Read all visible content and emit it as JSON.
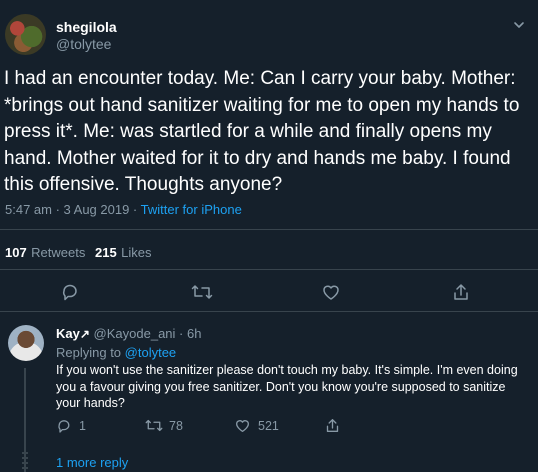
{
  "tweet": {
    "author_name": "shegilola",
    "author_handle": "@tolytee",
    "text_lines": [
      "I had an encounter today. Me: Can I carry your baby. Mother:",
      "*brings out hand sanitizer waiting for me to open my hands to",
      "press it*. Me: was startled for a while and finally opens my",
      "hand.  Mother waited for it to dry and hands me baby. I found",
      "this offensive. Thoughts anyone?"
    ],
    "timestamp": "5:47 am · 3 Aug 2019 · ",
    "source": "Twitter for iPhone",
    "retweets_count": "107",
    "retweets_label": "Retweets",
    "likes_count": "215",
    "likes_label": "Likes",
    "menu_icon": "chevron-down-icon"
  },
  "reply": {
    "author_name": "Kay",
    "author_badge": "↗",
    "author_handle": "@Kayode_ani · 6h",
    "replying_to_label": "Replying to ",
    "replying_to_handle": "@tolytee",
    "text_lines": [
      "If you won't use the sanitizer please don't touch my baby. It's simple. I'm even doing",
      "you a favour giving you free sanitizer. Don't you know you're supposed to sanitize",
      "your hands?"
    ],
    "reply_count": "1",
    "retweet_count": "78",
    "like_count": "521",
    "more_replies": "1 more reply"
  },
  "colors": {
    "background": "#15202b",
    "muted": "#8899a6",
    "accent": "#1da1f2",
    "divider": "#38444d"
  }
}
